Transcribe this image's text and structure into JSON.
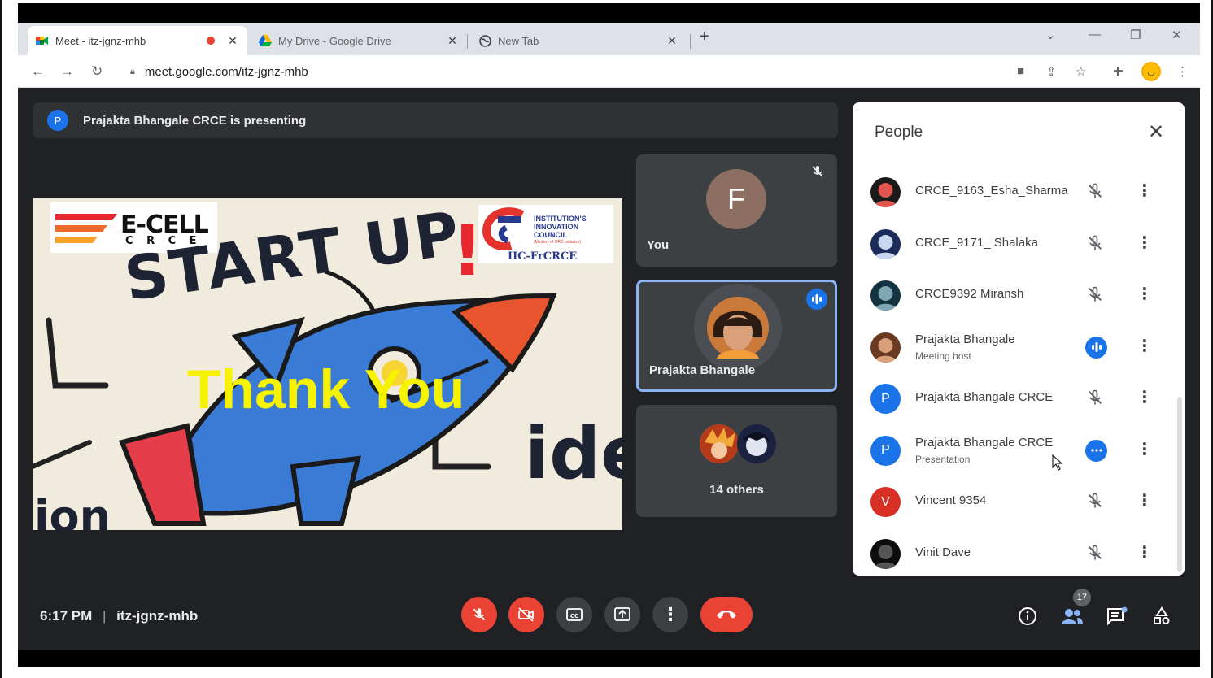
{
  "browser": {
    "tabs": [
      {
        "title": "Meet - itz-jgnz-mhb",
        "recording": true
      },
      {
        "title": "My Drive - Google Drive"
      },
      {
        "title": "New Tab"
      }
    ],
    "url": "meet.google.com/itz-jgnz-mhb"
  },
  "meet": {
    "presenting_banner": "Prajakta Bhangale CRCE is presenting",
    "presenter_initial": "P",
    "slide": {
      "ecell_text": "E-CELL",
      "ecell_sub": "C R C E",
      "iic_lines": [
        "INSTITUTION'S",
        "INNOVATION",
        "COUNCIL"
      ],
      "iic_small": "(Ministry of HRD Initiative)",
      "iic_caption": "IIC-FrCRCE",
      "startup_text": "START UP",
      "exclaim": "!",
      "thank_you": "Thank You",
      "ideas_text": "ide",
      "bottom_left_text": "ion"
    },
    "tiles": {
      "self_initial": "F",
      "self_label": "You",
      "speaker_label": "Prajakta Bhangale",
      "others_label": "14 others"
    },
    "people_panel": {
      "title": "People",
      "participants": [
        {
          "name": "CRCE_9163_Esha_Sharma",
          "sub": "",
          "avatar": "photo",
          "status": "muted"
        },
        {
          "name": "CRCE_9171_ Shalaka",
          "sub": "",
          "avatar": "photo",
          "status": "muted"
        },
        {
          "name": "CRCE9392 Miransh",
          "sub": "",
          "avatar": "photo",
          "status": "muted"
        },
        {
          "name": "Prajakta Bhangale",
          "sub": "Meeting host",
          "avatar": "photo",
          "status": "speaking"
        },
        {
          "name": "Prajakta Bhangale CRCE",
          "sub": "",
          "avatar_letter": "P",
          "avatar_color": "#1a73e8",
          "status": "muted"
        },
        {
          "name": "Prajakta Bhangale CRCE",
          "sub": "Presentation",
          "avatar_letter": "P",
          "avatar_color": "#1a73e8",
          "status": "more"
        },
        {
          "name": "Vincent 9354",
          "sub": "",
          "avatar_letter": "V",
          "avatar_color": "#d93025",
          "status": "muted"
        },
        {
          "name": "Vinit Dave",
          "sub": "",
          "avatar": "photo",
          "status": "muted"
        }
      ]
    },
    "bottom": {
      "time": "6:17 PM",
      "meeting_code": "itz-jgnz-mhb",
      "people_count": "17"
    }
  }
}
